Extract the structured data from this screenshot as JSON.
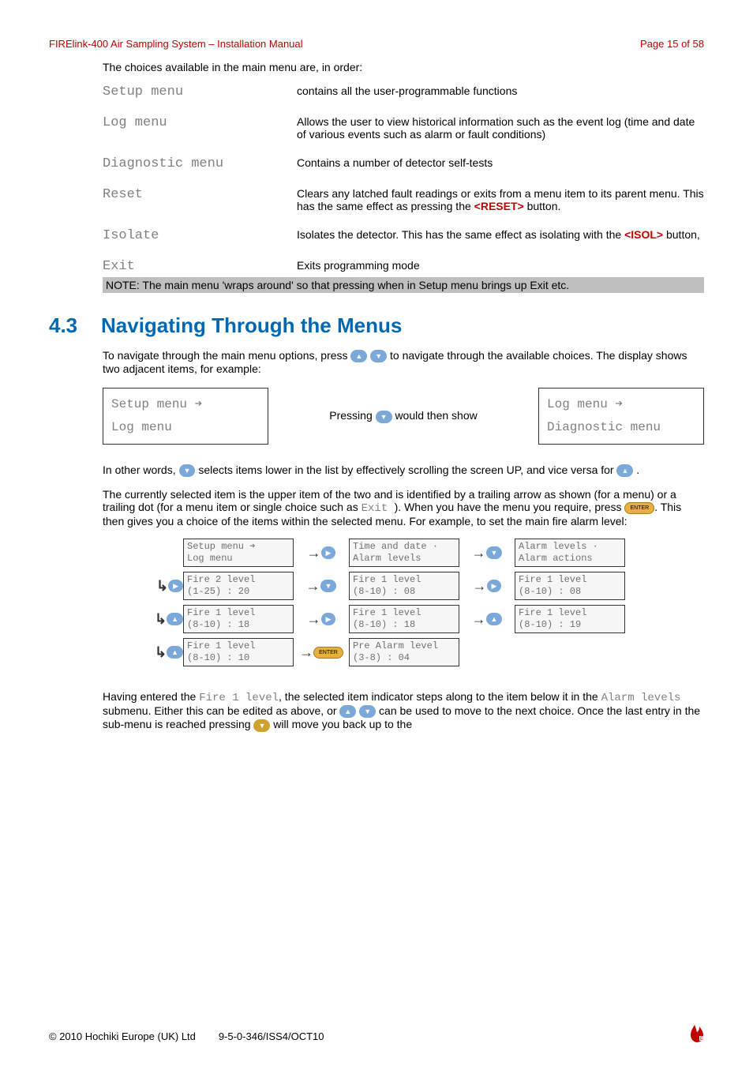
{
  "header": {
    "title": "FIRElink-400 Air Sampling System – Installation Manual",
    "page": "Page 15 of 58"
  },
  "intro": "The choices available in the main menu are, in order:",
  "menu": {
    "setup": {
      "label": "Setup menu",
      "desc": "contains all the user-programmable functions"
    },
    "log": {
      "label": "Log menu",
      "desc": "Allows the user to view historical information such as the event log (time and date of various events such as alarm or fault conditions)"
    },
    "diag": {
      "label": "Diagnostic menu",
      "desc": "Contains a number of detector self-tests"
    },
    "reset": {
      "label": "Reset",
      "desc_pre": "Clears any latched fault readings or exits from a menu item to its parent menu.  This has the same effect as pressing the ",
      "btn": "<RESET>",
      "desc_post": " button."
    },
    "isolate": {
      "label": "Isolate",
      "desc_pre": "Isolates the detector.  This has the same effect as isolating with the ",
      "btn": "<ISOL>",
      "desc_post": " button,"
    },
    "exit": {
      "label": "Exit",
      "desc": "Exits programming mode"
    }
  },
  "note": "NOTE: The main menu 'wraps around' so that pressing  when in Setup menu brings up Exit etc.",
  "section": {
    "num": "4.3",
    "title": "Navigating Through the Menus"
  },
  "nav_para1_pre": "To navigate through the main menu options, press ",
  "nav_para1_post": " to navigate through the available choices.  The display shows two adjacent items, for example:",
  "lcd1": {
    "l1": "Setup menu ➔",
    "l2": "Log menu"
  },
  "between": {
    "pre": "Pressing ",
    "post": " would then show"
  },
  "lcd2": {
    "l1": "Log menu ➔",
    "l2": "Diagnostic menu"
  },
  "nav_para2": {
    "pre": "In other words, ",
    "mid": " selects items lower in the list by effectively scrolling the screen UP, and vice versa for ",
    "post": "."
  },
  "nav_para3": {
    "p1": "The currently selected item is the upper item of the two and is identified by a trailing arrow as shown (for a menu) or a trailing dot (for a menu item or single choice such as ",
    "exit": "Exit ",
    "p2": ").  When you have the menu you require, press ",
    "p3": ".  This then gives you a choice of the items within the selected menu.  For example, to set the main fire alarm level:"
  },
  "diagram": {
    "r1": {
      "c1": {
        "l1": "Setup menu  ➔",
        "l2": "Log menu"
      },
      "c2": {
        "l1": "Time and date ·",
        "l2": "Alarm levels"
      },
      "c3": {
        "l1": "Alarm levels  ·",
        "l2": "Alarm actions"
      }
    },
    "r2": {
      "c1": {
        "l1": "Fire 2 level",
        "l2": "(1-25)  :  20"
      },
      "c2": {
        "l1": "Fire 1 level",
        "l2": "(8-10)  :  08"
      },
      "c3": {
        "l1": "Fire 1 level",
        "l2": "(8-10)  :  08"
      }
    },
    "r3": {
      "c1": {
        "l1": "Fire 1 level",
        "l2": "(8-10)  :  18"
      },
      "c2": {
        "l1": "Fire 1 level",
        "l2": "(8-10)  :  18"
      },
      "c3": {
        "l1": "Fire 1 level",
        "l2": "(8-10)  :  19"
      }
    },
    "r4": {
      "c1": {
        "l1": "Fire 1 level",
        "l2": "(8-10)  :  10"
      },
      "c2": {
        "l1": "Pre Alarm level",
        "l2": "(3-8)  :  04"
      }
    }
  },
  "closing": {
    "p1": "Having entered the ",
    "fire": "Fire 1 level",
    "p2": ", the selected item indicator steps along to the item below it in the ",
    "alarm": "Alarm levels",
    "p3": " submenu.  Either this can be edited as above, or ",
    "p4": " can be used to move to the next choice.  Once the last entry in the sub-menu is reached pressing ",
    "p5": " will move you back up to the"
  },
  "footer": {
    "copy": "© 2010 Hochiki Europe (UK) Ltd",
    "doc": "9-5-0-346/ISS4/OCT10"
  }
}
